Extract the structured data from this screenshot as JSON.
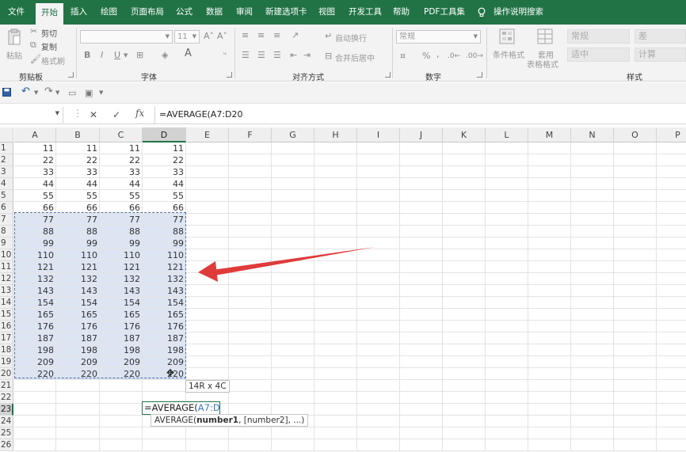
{
  "menu": {
    "items": [
      "文件",
      "开始",
      "插入",
      "绘图",
      "页面布局",
      "公式",
      "数据",
      "审阅",
      "新建选项卡",
      "视图",
      "开发工具",
      "帮助",
      "PDF工具集"
    ],
    "active": "开始",
    "tell_me": "操作说明搜索"
  },
  "ribbon": {
    "clipboard": {
      "label": "剪贴板",
      "paste": "粘贴",
      "cut": "剪切",
      "copy": "复制",
      "format_painter": "格式刷"
    },
    "font": {
      "label": "字体",
      "font_size": "11",
      "bold": "B",
      "italic": "I",
      "underline": "U"
    },
    "alignment": {
      "label": "对齐方式",
      "wrap": "自动换行",
      "merge": "合并后居中"
    },
    "number": {
      "label": "数字",
      "format": "常规",
      "percent": "%",
      "comma": ","
    },
    "styles": {
      "label": "样式",
      "conditional": "条件格式",
      "table_format_1": "套用",
      "table_format_2": "表格格式",
      "normal": "常规",
      "bad": "差",
      "neutral": "适中",
      "calculation": "计算"
    }
  },
  "formula_bar": {
    "name_box": "",
    "formula": "=AVERAGE(A7:D20"
  },
  "columns": [
    "A",
    "B",
    "C",
    "D",
    "E",
    "F",
    "G",
    "H",
    "I",
    "J",
    "K",
    "L",
    "M",
    "N",
    "O",
    "P"
  ],
  "rows": [
    "1",
    "2",
    "3",
    "4",
    "5",
    "6",
    "7",
    "8",
    "9",
    "10",
    "11",
    "12",
    "13",
    "14",
    "15",
    "16",
    "17",
    "18",
    "19",
    "20",
    "21",
    "22",
    "23",
    "24",
    "25",
    "26"
  ],
  "data_values": [
    "11",
    "22",
    "33",
    "44",
    "55",
    "66",
    "77",
    "88",
    "99",
    "110",
    "121",
    "132",
    "143",
    "154",
    "165",
    "176",
    "187",
    "198",
    "209",
    "220"
  ],
  "selection_tip": "14R x 4C",
  "edit_cell": {
    "prefix": "=AVERAGE(",
    "ref": "A7:D20"
  },
  "arg_tip": {
    "func": "AVERAGE(",
    "arg1": "number1",
    "rest": ", [number2], ...)"
  },
  "accent": "#217346",
  "arrow_color": "#e03b3b"
}
